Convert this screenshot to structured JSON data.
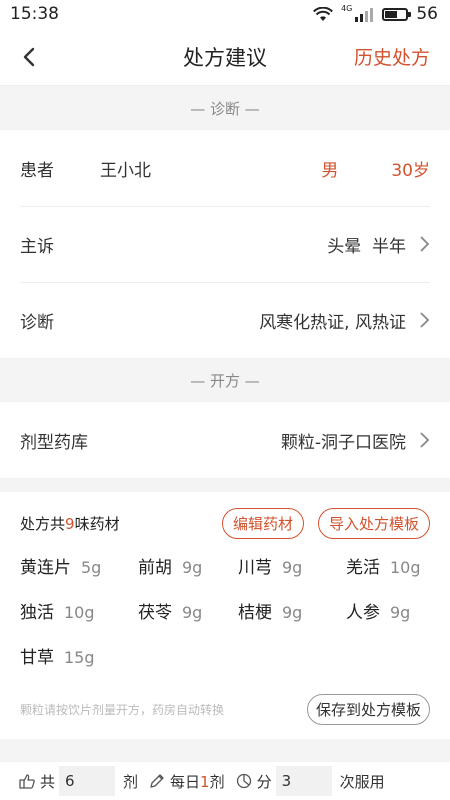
{
  "status": {
    "time": "15:38",
    "network": "4G",
    "battery": "56",
    "battery_level": 0.56
  },
  "nav": {
    "title": "处方建议",
    "right_link": "历史处方"
  },
  "diagnosis_section": {
    "title": "— 诊断 —"
  },
  "patient": {
    "label": "患者",
    "name": "王小北",
    "gender": "男",
    "age": "30岁"
  },
  "complaint": {
    "label": "主诉",
    "value": "头晕  半年"
  },
  "diagnosis": {
    "label": "诊断",
    "value": "风寒化热证, 风热证"
  },
  "prescribe_section": {
    "title": "— 开方 —"
  },
  "pharmacy": {
    "label": "剂型药库",
    "value": "颗粒-洞子口医院"
  },
  "rx": {
    "count_prefix": "处方共",
    "count": "9",
    "count_suffix": "味药材",
    "edit_button": "编辑药材",
    "import_button": "导入处方模板",
    "herbs": [
      {
        "name": "黄连片",
        "dose": "5g"
      },
      {
        "name": "前胡",
        "dose": "9g"
      },
      {
        "name": "川芎",
        "dose": "9g"
      },
      {
        "name": "羌活",
        "dose": "10g"
      },
      {
        "name": "独活",
        "dose": "10g"
      },
      {
        "name": "茯苓",
        "dose": "9g"
      },
      {
        "name": "桔梗",
        "dose": "9g"
      },
      {
        "name": "人参",
        "dose": "9g"
      },
      {
        "name": "甘草",
        "dose": "15g"
      }
    ],
    "note": "颗粒请按饮片剂量开方，药房自动转换",
    "save_button": "保存到处方模板"
  },
  "dosage": {
    "total_label": "共",
    "total_value": "6",
    "total_unit": "剂",
    "daily_prefix": "每日",
    "daily_count": "1",
    "daily_suffix": "剂",
    "split_label": "分",
    "split_value": "3",
    "split_unit": "次服用"
  }
}
